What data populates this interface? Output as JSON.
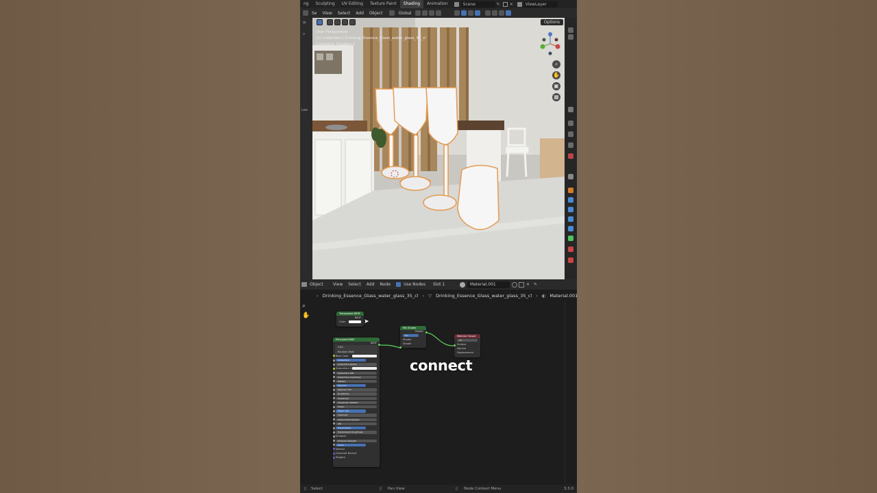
{
  "workspace_tabs": [
    "ng",
    "Sculpting",
    "UV Editing",
    "Texture Paint",
    "Shading",
    "Animation"
  ],
  "active_tab": "Shading",
  "scene_name": "Scene",
  "view_layer": "ViewLayer",
  "viewport_menu": [
    "Se",
    "View",
    "Select",
    "Add",
    "Object"
  ],
  "transform_orientation": "Global",
  "viewport": {
    "line1": "User Perspective",
    "line2": "(1) Collection | Drinking_Essence_Glass_water_glass_35_cl",
    "line3": "Compiling Shaders 1",
    "options_label": "Options",
    "left_label_top": "Lea"
  },
  "node_editor": {
    "editor_type": "Object",
    "menu": [
      "View",
      "Select",
      "Add",
      "Node"
    ],
    "use_nodes_label": "Use Nodes",
    "slot": "Slot 1",
    "material": "Material.001"
  },
  "breadcrumb": {
    "object": "Drinking_Essence_Glass_water_glass_35_cl",
    "mesh": "Drinking_Essence_Glass_water_glass_35_cl",
    "material": "Material.001"
  },
  "nodes": {
    "transparent": {
      "title": "Transparent BSDF",
      "out": "BSDF",
      "row": "Color"
    },
    "principled": {
      "title": "Principled BSDF",
      "out": "BSDF",
      "rows": [
        "GGX",
        "Random Walk",
        "Base Color",
        "Subsurface",
        "Subsurface Radius",
        "Subsurface Color",
        "Subsurface IOR",
        "Subsurface Anisotropy",
        "Metallic",
        "Specular",
        "Specular Tint",
        "Roughness",
        "Anisotropic",
        "Anisotropic Rotation",
        "Sheen",
        "Sheen Tint",
        "Clearcoat",
        "Clearcoat Roughness",
        "IOR",
        "Transmission",
        "Transmission Roughness",
        "Emission",
        "Emission Strength",
        "Alpha",
        "Normal",
        "Clearcoat Normal",
        "Tangent"
      ]
    },
    "mix": {
      "title": "Mix Shader",
      "out": "Shader",
      "rows": [
        "Fac",
        "Shader",
        "Shader"
      ]
    },
    "output": {
      "title": "Material Output",
      "rows": [
        "All",
        "Surface",
        "Volume",
        "Displacement"
      ]
    }
  },
  "caption": "connect",
  "status": {
    "left": "Select",
    "middle": "Pan View",
    "right": "Node Context Menu",
    "version": "3.3.0"
  },
  "colors": {
    "selection_outline": "#e59a4f",
    "active_blue": "#4772b3",
    "shader_header_green": "#2f6a37",
    "output_header_red": "#6a2a35",
    "socket_shader": "#5fd35f",
    "socket_color": "#c7c729"
  }
}
